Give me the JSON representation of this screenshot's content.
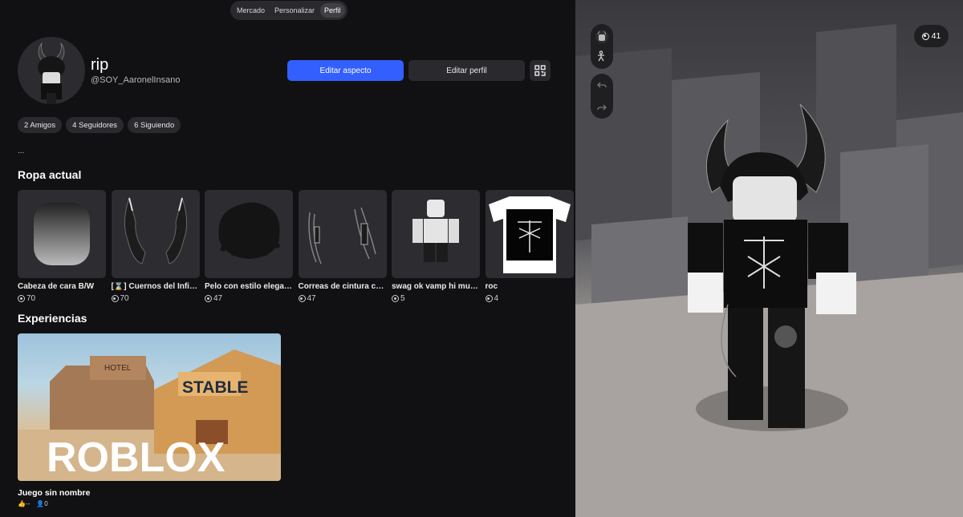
{
  "nav": {
    "tabs": [
      {
        "label": "Mercado"
      },
      {
        "label": "Personalizar"
      },
      {
        "label": "Perfil"
      }
    ]
  },
  "profile": {
    "display_name": "rip",
    "username": "@SOY_AaronelInsano",
    "edit_avatar_label": "Editar aspecto",
    "edit_profile_label": "Editar perfil",
    "friends": "2 Amigos",
    "followers": "4 Seguidores",
    "following": "6 Siguiendo",
    "bio": "..."
  },
  "current_wear": {
    "title": "Ropa actual",
    "items": [
      {
        "name": "Cabeza de cara B/W",
        "price": "70"
      },
      {
        "name": "[⌛] Cuernos del Infierno",
        "price": "70"
      },
      {
        "name": "Pelo con estilo elegante",
        "price": "47"
      },
      {
        "name": "Correas de cintura con cadenas",
        "price": "47"
      },
      {
        "name": "swag ok vamp hi muñeco",
        "price": "5"
      },
      {
        "name": "roc",
        "price": "4"
      }
    ]
  },
  "experiences": {
    "title": "Experiencias",
    "items": [
      {
        "name": "Juego sin nombre",
        "likes": "--",
        "players": "0",
        "thumb_sign": "STABLE",
        "thumb_hotel": "HOTEL",
        "thumb_logo": "ROBLOX"
      }
    ]
  },
  "viewer": {
    "balance": "41"
  },
  "colors": {
    "accent": "#335fff",
    "background": "#111114",
    "panel": "#2a2a2e"
  }
}
